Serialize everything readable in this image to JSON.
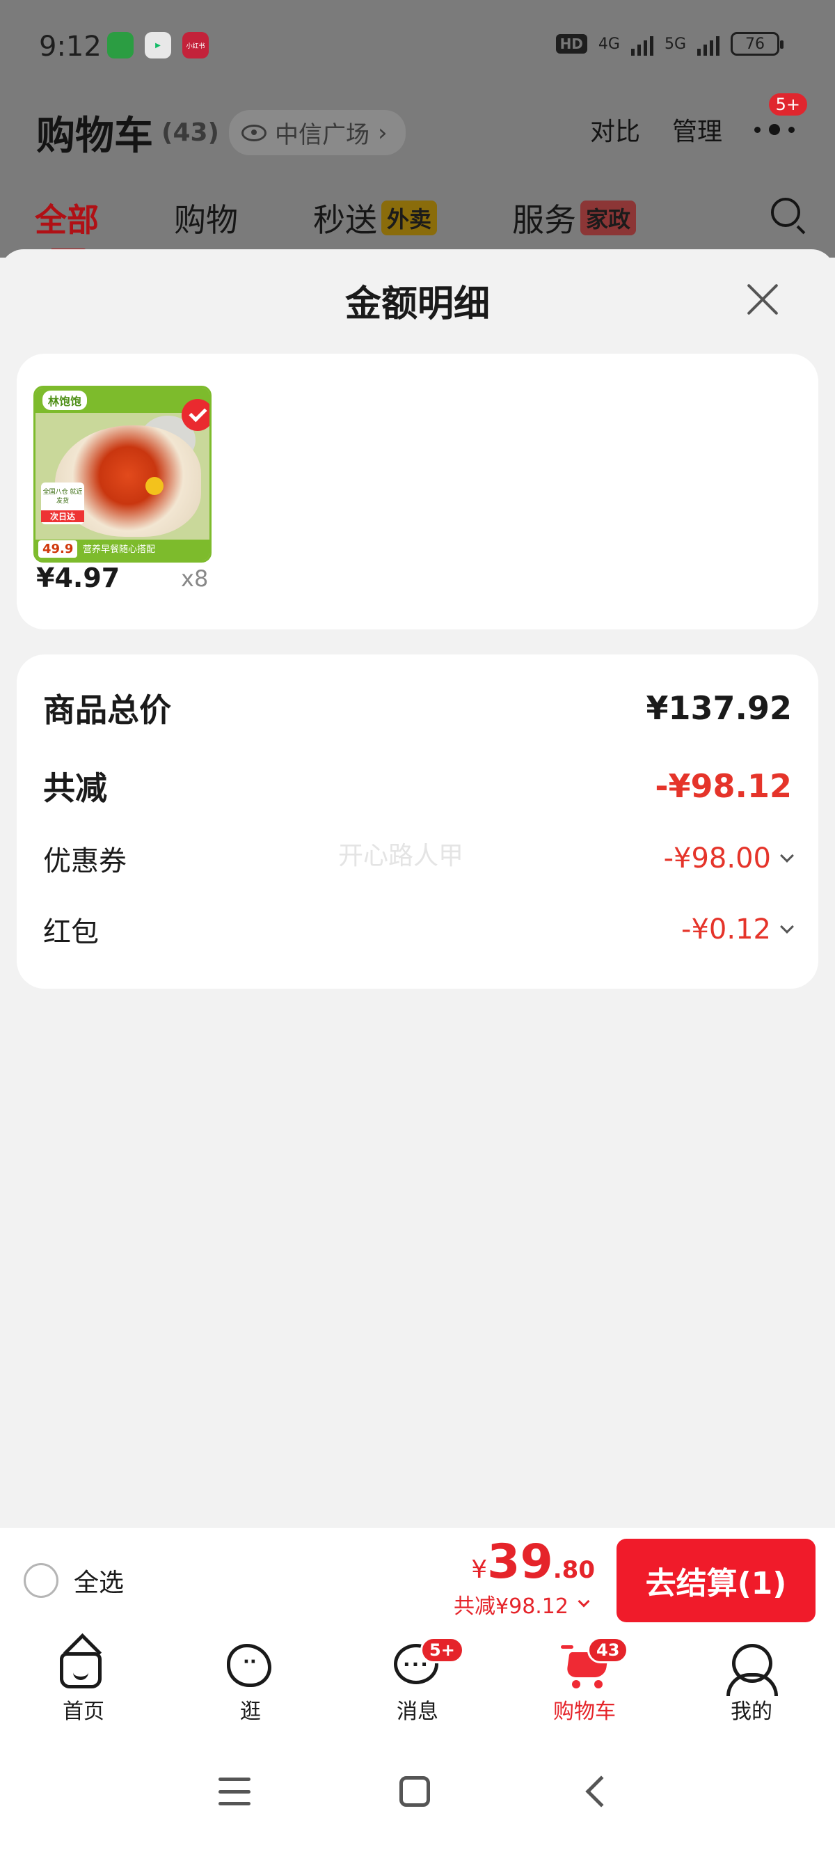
{
  "status_bar": {
    "time": "9:12",
    "apps": [
      "微信",
      "视频",
      "小红书"
    ],
    "hd_label": "HD",
    "network_4g": "4G",
    "network_5g": "5G",
    "battery": "76"
  },
  "background_header": {
    "title": "购物车",
    "count": "(43)",
    "location": "中信广场",
    "compare": "对比",
    "manage": "管理",
    "more_badge": "5+",
    "tabs": [
      {
        "label": "全部",
        "tag": ""
      },
      {
        "label": "购物",
        "tag": ""
      },
      {
        "label": "秒送",
        "tag": "外卖"
      },
      {
        "label": "服务",
        "tag": "家政"
      }
    ]
  },
  "sheet": {
    "title": "金额明细",
    "product": {
      "image_brand": "林饱饱",
      "image_tag_line": "全国八仓 就近发货",
      "image_tag_badge": "次日达",
      "image_bottom": "营养早餐随心搭配",
      "image_price_chip": "49.9",
      "price": "¥4.97",
      "qty": "x8"
    },
    "rows": {
      "total_label": "商品总价",
      "total_value": "¥137.92",
      "reduce_label": "共减",
      "reduce_value": "-¥98.12",
      "coupon_label": "优惠券",
      "coupon_value": "-¥98.00",
      "redpack_label": "红包",
      "redpack_value": "-¥0.12"
    },
    "watermark": "开心路人甲"
  },
  "checkout": {
    "select_all": "全选",
    "currency": "¥",
    "price_int": "39",
    "price_dec": ".80",
    "reduce_text": "共减¥98.12",
    "button": "去结算(1)"
  },
  "bottom_nav": {
    "items": [
      {
        "label": "首页",
        "icon": "home-icon"
      },
      {
        "label": "逛",
        "icon": "stroll-icon"
      },
      {
        "label": "消息",
        "icon": "message-icon",
        "badge": "5+"
      },
      {
        "label": "购物车",
        "icon": "cart-icon",
        "badge": "43"
      },
      {
        "label": "我的",
        "icon": "user-icon"
      }
    ]
  },
  "colors": {
    "accent": "#E5242A",
    "checkout_button": "#F01B2A",
    "sheet_bg": "#F2F2F2"
  }
}
